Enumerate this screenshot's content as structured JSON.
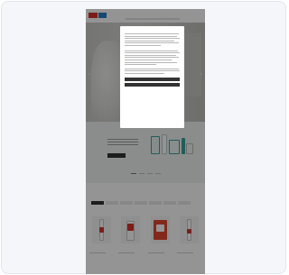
{
  "header": {
    "nav": [
      "",
      "",
      "",
      "",
      ""
    ]
  },
  "cookie_modal": {
    "title": "",
    "accept_label": "",
    "reject_label": "",
    "settings_label": "",
    "privacy_label": ""
  },
  "teaser": {
    "heading": "",
    "button_label": ""
  },
  "products": {
    "section_title": "",
    "filters": [
      "",
      "",
      "",
      "",
      "",
      "",
      ""
    ],
    "items": [
      {
        "name": ""
      },
      {
        "name": ""
      },
      {
        "name": ""
      },
      {
        "name": ""
      }
    ]
  },
  "colors": {
    "brand_red": "#d8322b",
    "brand_blue": "#2e7bc4",
    "dark_button": "#333333",
    "teal_accent": "#3aa39a"
  }
}
